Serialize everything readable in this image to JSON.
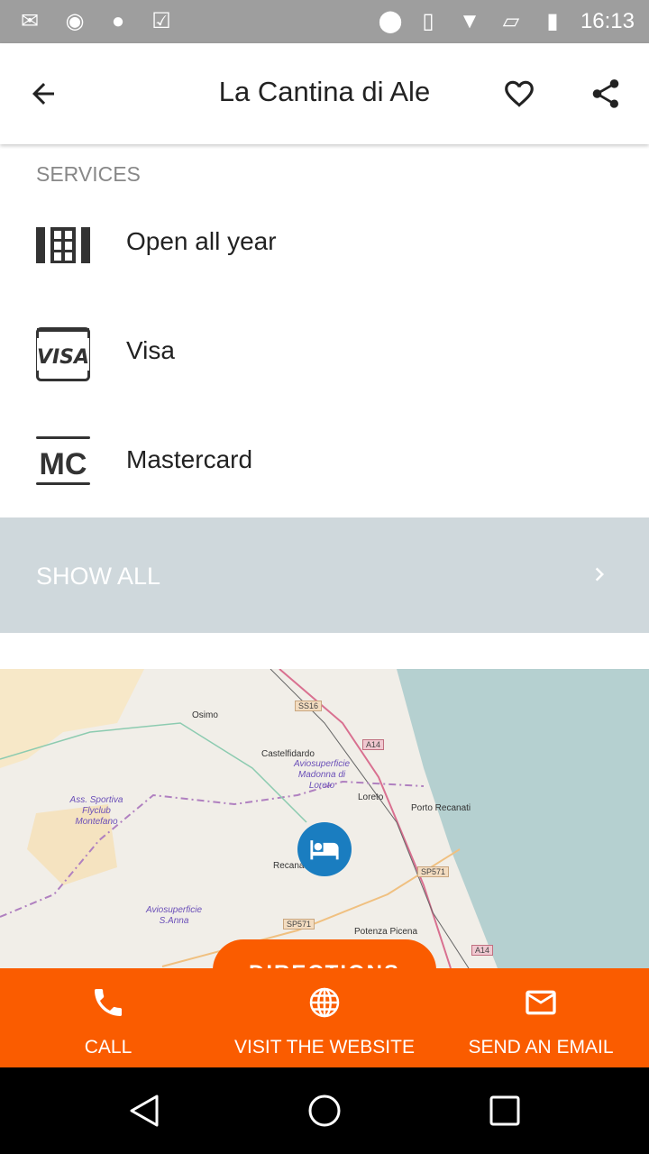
{
  "status_bar": {
    "time": "16:13",
    "left_icons": [
      "gmail-icon",
      "disc-icon",
      "android-icon",
      "clipboard-check-icon"
    ],
    "right_icons": [
      "location-icon",
      "vibrate-icon",
      "wifi-icon",
      "no-sim-icon",
      "battery-charging-icon"
    ]
  },
  "header": {
    "title": "La Cantina di Ale",
    "back_icon": "arrow-left-icon",
    "favorite_icon": "heart-outline-icon",
    "share_icon": "share-icon"
  },
  "services": {
    "heading": "SERVICES",
    "items": [
      {
        "label": "Open all year",
        "icon": "calendar-grid-icon"
      },
      {
        "label": "Visa",
        "icon": "visa-card-icon"
      },
      {
        "label": "Mastercard",
        "icon": "mastercard-icon"
      }
    ],
    "show_all": "SHOW ALL"
  },
  "map": {
    "places": [
      "Osimo",
      "Castelfidardo",
      "Loreto",
      "Porto Recanati",
      "Recanati",
      "Potenza Picena"
    ],
    "airfields": [
      "Aviosuperficie Madonna di Loreto",
      "Ass. Sportiva Flyclub Montefano",
      "Aviosuperficie S.Anna"
    ],
    "roads": [
      "SS16",
      "A14",
      "SP571",
      "SP571",
      "A14"
    ],
    "marker_icon": "bed-icon",
    "directions_label": "DIRECTIONS"
  },
  "actions": [
    {
      "label": "CALL",
      "icon": "phone-icon"
    },
    {
      "label": "VISIT THE WEBSITE",
      "icon": "globe-icon"
    },
    {
      "label": "SEND AN EMAIL",
      "icon": "mail-icon"
    }
  ],
  "colors": {
    "accent": "#fa5c00",
    "show_all_bg": "#cfd8dc",
    "marker": "#1a7dc0",
    "status_bar": "#9e9e9e"
  }
}
